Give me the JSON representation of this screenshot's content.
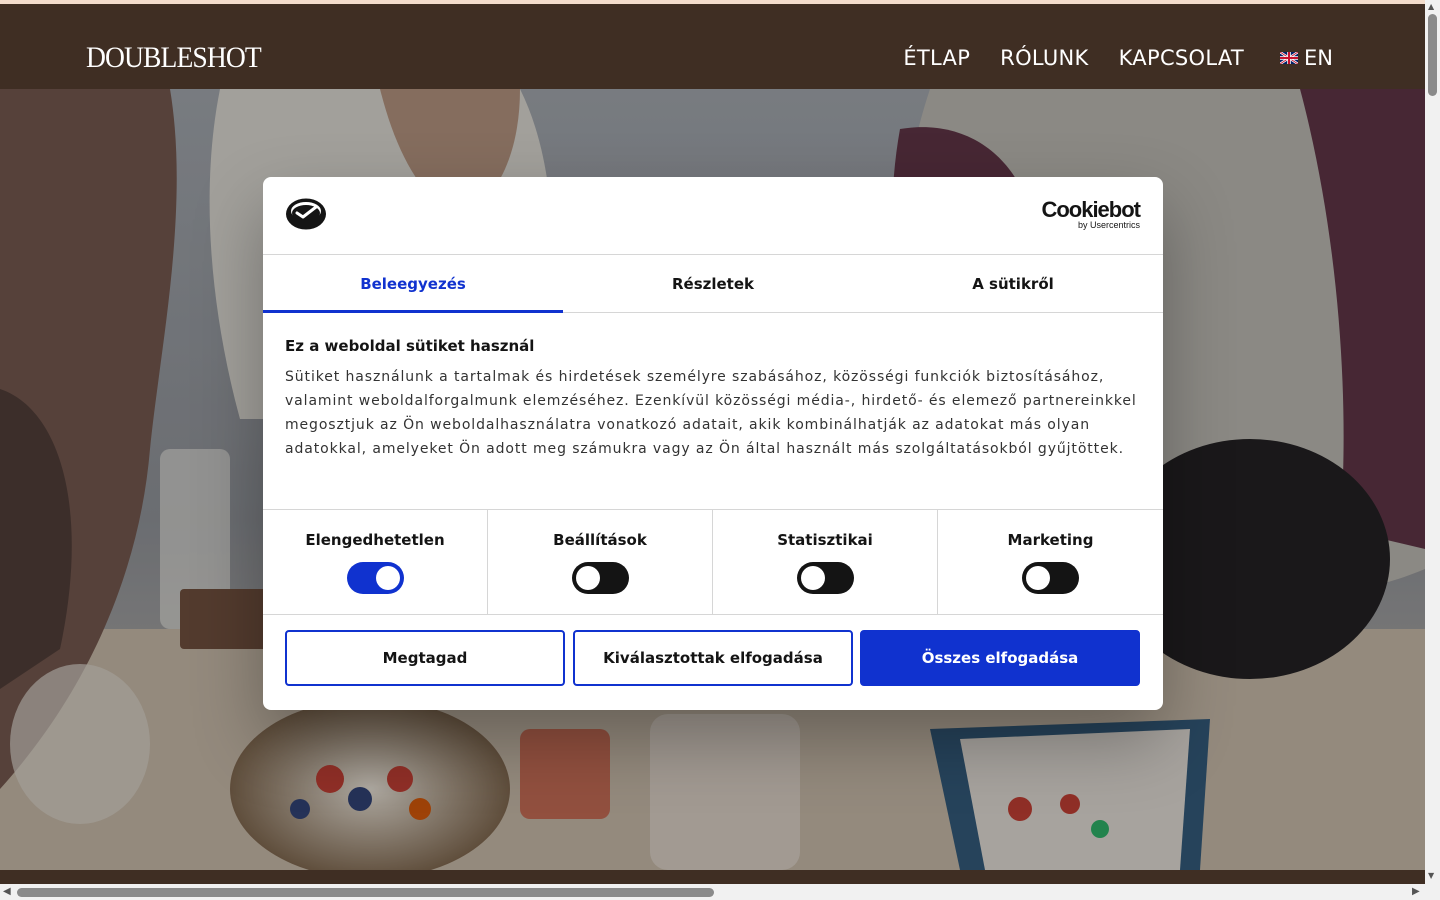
{
  "site": {
    "logo": "DOUBLESHOT",
    "nav": [
      {
        "label": "ÉTLAP"
      },
      {
        "label": "RÓLUNK"
      },
      {
        "label": "KAPCSOLAT"
      }
    ],
    "language": {
      "label": "EN",
      "flag": "uk-flag-icon"
    }
  },
  "cookie_dialog": {
    "provider": {
      "name": "Cookiebot",
      "sub": "by Usercentrics"
    },
    "tabs": [
      {
        "label": "Beleegyezés",
        "active": true
      },
      {
        "label": "Részletek",
        "active": false
      },
      {
        "label": "A sütikről",
        "active": false
      }
    ],
    "title": "Ez a weboldal sütiket használ",
    "body": "Sütiket használunk a tartalmak és hirdetések személyre szabásához, közösségi funkciók biztosításához, valamint weboldalforgalmunk elemzéséhez. Ezenkívül közösségi média-, hirdető- és elemező partnereinkkel megosztjuk az Ön weboldalhasználatra vonatkozó adatait, akik kombinálhatják az adatokat más olyan adatokkal, amelyeket Ön adott meg számukra vagy az Ön által használt más szolgáltatásokból gyűjtöttek.",
    "categories": [
      {
        "label": "Elengedhetetlen",
        "checked": true
      },
      {
        "label": "Beállítások",
        "checked": false
      },
      {
        "label": "Statisztikai",
        "checked": false
      },
      {
        "label": "Marketing",
        "checked": false
      }
    ],
    "buttons": {
      "deny": "Megtagad",
      "accept_selected": "Kiválasztottak elfogadása",
      "accept_all": "Összes elfogadása"
    }
  },
  "colors": {
    "header_bg": "#3f2e23",
    "accent": "#1032cf",
    "text": "#141414"
  }
}
